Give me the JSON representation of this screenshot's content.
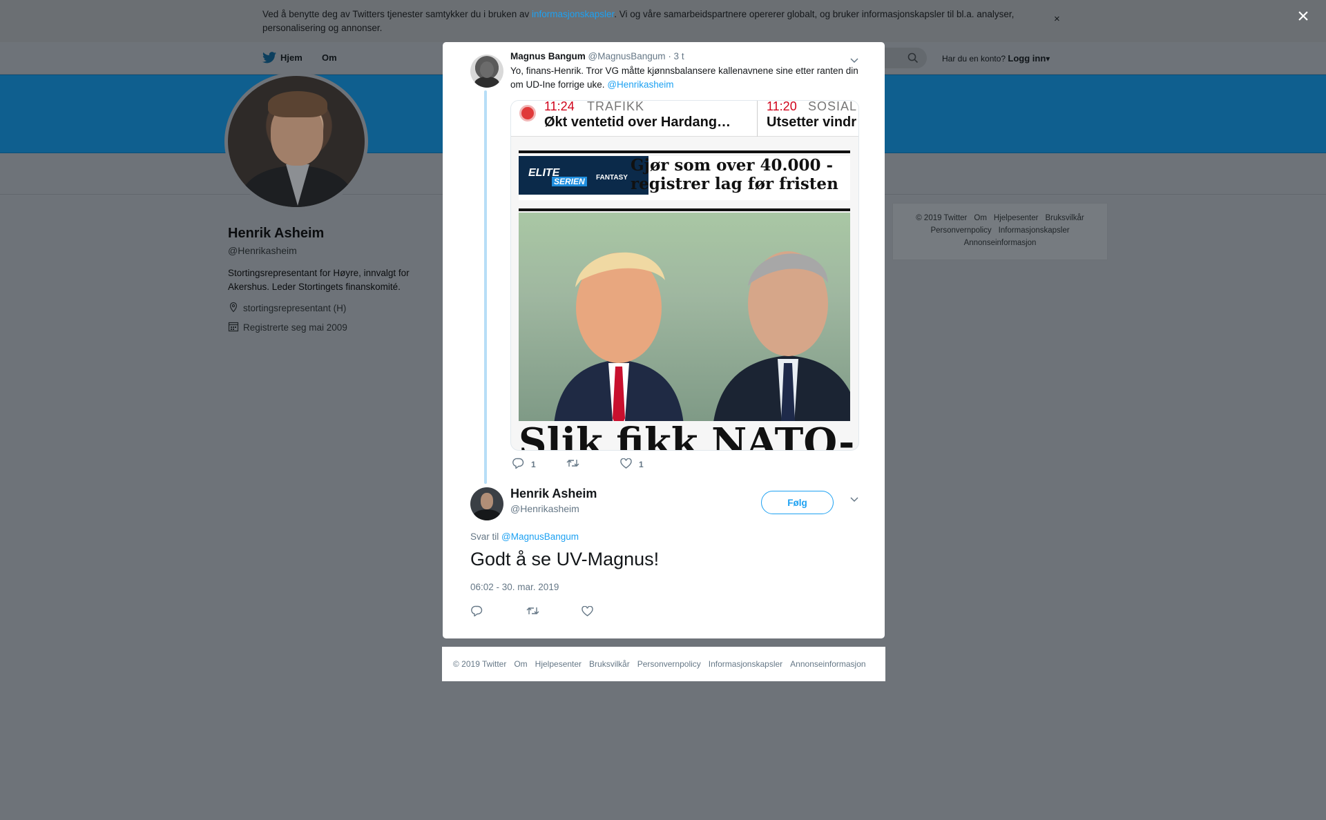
{
  "cookie_banner": {
    "text_before": "Ved å benytte deg av Twitters tjenester samtykker du i bruken av ",
    "link": "informasjonskapsler",
    "text_after": ". Vi og våre samarbeidspartnere opererer globalt, og bruker informasjonskapsler til bl.a. analyser, personalisering og annonser.",
    "close": "×"
  },
  "overlay_close": "×",
  "nav": {
    "home": "Hjem",
    "about": "Om",
    "account_prompt": "Har du en konto?",
    "login": "Logg inn"
  },
  "profile": {
    "name": "Henrik Asheim",
    "handle": "@Henrikasheim",
    "bio": "Stortingsrepresentant for Høyre, innvalgt for Akershus. Leder Stortingets finanskomité.",
    "location": "stortingsrepresentant (H)",
    "joined": "Registrerte seg mai 2009"
  },
  "side_footer": [
    "© 2019 Twitter",
    "Om",
    "Hjelpesenter",
    "Bruksvilkår",
    "Personvernpolicy",
    "Informasjonskapsler",
    "Annonseinformasjon"
  ],
  "parent_tweet": {
    "name": "Magnus Bangum",
    "handle": "@MagnusBangum",
    "time": "· 3 t",
    "text": "Yo, finans-Henrik. Tror VG måtte kjønnsbalansere kallenavnene sine etter ranten din om UD-Ine forrige uke. ",
    "mention": "@Henrikasheim",
    "media": {
      "ticker": [
        {
          "time": "11:24",
          "category": "TRAFIKK",
          "headline": "Økt ventetid over Hardang…"
        },
        {
          "time": "11:20",
          "category": "SOSIAL",
          "headline": "Utsetter vindr"
        }
      ],
      "ad_logo_1": "ELITE",
      "ad_logo_2": "SERIEN",
      "ad_logo_3": "FANTASY",
      "ad_line1": "Gjør som over 40.000 -",
      "ad_line2": "registrer lag før fristen",
      "big_headline": "Slik fikk NATO-"
    },
    "replies": "1",
    "retweets": "",
    "likes": "1"
  },
  "main_tweet": {
    "name": "Henrik Asheim",
    "handle": "@Henrikasheim",
    "follow_label": "Følg",
    "reply_to_label": "Svar til",
    "reply_to_handle": "@MagnusBangum",
    "text": "Godt å se UV-Magnus!",
    "timestamp": "06:02 - 30. mar. 2019"
  },
  "modal_footer": [
    "© 2019 Twitter",
    "Om",
    "Hjelpesenter",
    "Bruksvilkår",
    "Personvernpolicy",
    "Informasjonskapsler",
    "Annonseinformasjon"
  ],
  "colors": {
    "twitter_blue": "#1da1f2",
    "overlay": "#6e7379",
    "header_band": "#0f5f8f"
  }
}
